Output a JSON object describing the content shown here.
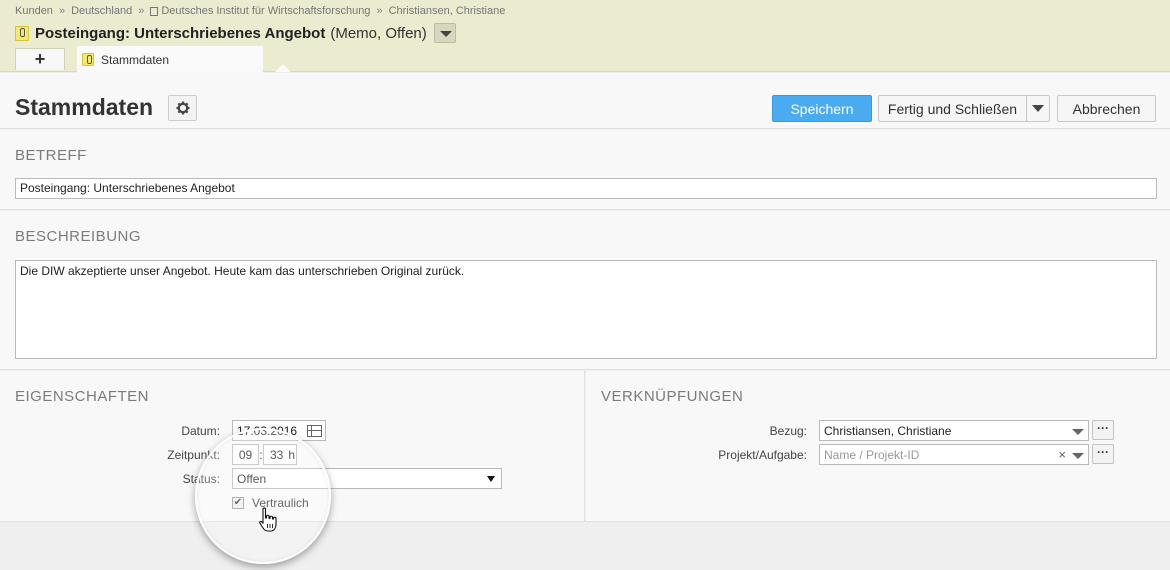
{
  "breadcrumb": {
    "items": [
      "Kunden",
      "Deutschland",
      "Deutsches Institut für Wirtschaftsforschung",
      "Christiansen, Christiane"
    ],
    "separator": "»"
  },
  "header": {
    "title": "Posteingang: Unterschriebenes Angebot",
    "subtitle": "(Memo, Offen)"
  },
  "tabs": {
    "add_label": "+",
    "active_label": "Stammdaten"
  },
  "toolbar": {
    "page_title": "Stammdaten",
    "save_label": "Speichern",
    "finish_label": "Fertig und Schließen",
    "cancel_label": "Abbrechen"
  },
  "betreff": {
    "section_title": "BETREFF",
    "value": "Posteingang: Unterschriebenes Angebot"
  },
  "beschreibung": {
    "section_title": "BESCHREIBUNG",
    "value": "Die DIW akzeptierte unser Angebot. Heute kam das unterschrieben Original zurück."
  },
  "eigenschaften": {
    "section_title": "EIGENSCHAFTEN",
    "datum_label": "Datum:",
    "datum_value": "17.03.2016",
    "zeit_label": "Zeitpunkt:",
    "zeit_hour": "09",
    "zeit_sep": ":",
    "zeit_minute": "33",
    "zeit_unit": "h",
    "status_label": "Status:",
    "status_value": "Offen",
    "vertraulich_label": "Vertraulich",
    "vertraulich_checked": "✔"
  },
  "verknuepfungen": {
    "section_title": "VERKNÜPFUNGEN",
    "bezug_label": "Bezug:",
    "bezug_value": "Christiansen, Christiane",
    "projekt_label": "Projekt/Aufgabe:",
    "projekt_placeholder": "Name / Projekt-ID",
    "more_label": "···",
    "clear_label": "×"
  },
  "colors": {
    "header_bg": "#ebebd0",
    "accent": "#4aabf0",
    "memo_yellow": "#f5e96b"
  }
}
